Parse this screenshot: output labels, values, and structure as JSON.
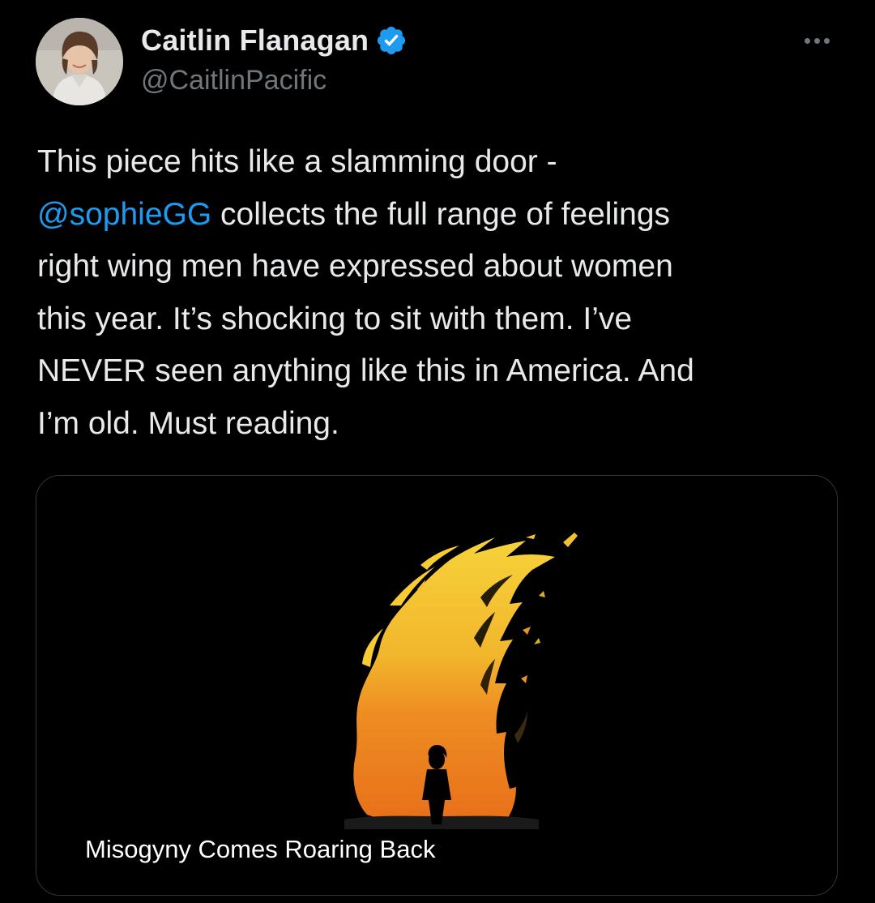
{
  "author": {
    "display_name": "Caitlin Flanagan",
    "handle": "@CaitlinPacific",
    "verified_icon": "verified-badge-icon"
  },
  "menu": {
    "icon": "more-icon"
  },
  "tweet": {
    "lines": [
      {
        "text": "This piece hits like a slamming door -"
      },
      {
        "mention": "@sophieGG",
        "text": " collects the full range of feelings"
      },
      {
        "text": "right wing men have expressed about women"
      },
      {
        "text": "this year. It’s shocking to sit with them. I’ve"
      },
      {
        "text": "NEVER seen anything like this in America. And"
      },
      {
        "text": "I’m old. Must reading."
      }
    ]
  },
  "card": {
    "title": "Misogyny Comes Roaring Back",
    "image_icon": "flame-figure-illustration"
  },
  "colors": {
    "background": "#000000",
    "text": "#e7e9ea",
    "secondary": "#71767b",
    "accent": "#1d9bf0",
    "flame_yellow": "#f4c430",
    "flame_orange": "#ec7a1c"
  }
}
